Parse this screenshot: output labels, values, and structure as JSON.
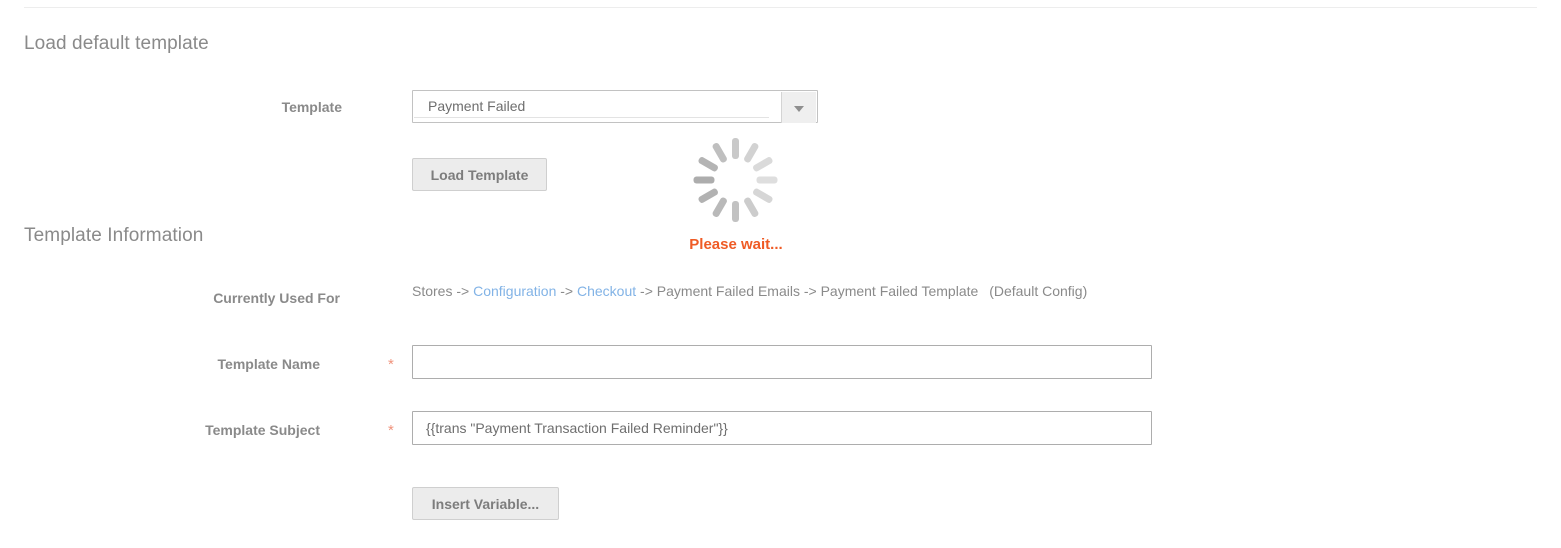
{
  "sections": {
    "load_default": "Load default template",
    "template_information": "Template Information"
  },
  "template_row": {
    "label": "Template",
    "selected_option": "Payment Failed",
    "arrow_icon": "chevron-down-icon"
  },
  "buttons": {
    "load_template": "Load Template",
    "insert_variable": "Insert Variable..."
  },
  "loader": {
    "icon": "spinner-icon",
    "message": "Please wait...",
    "accent_color": "#ef5b25",
    "spoke_colors": [
      "#c9c9c9",
      "#d2d2d2",
      "#dadada",
      "#dedede",
      "#d6d6d6",
      "#cccccc",
      "#c2c2c2",
      "#b9b9b9",
      "#b2b2b2",
      "#adadad",
      "#b4b4b4",
      "#bfbfbf"
    ]
  },
  "currently_used_for": {
    "label": "Currently Used For",
    "parts": {
      "stores": "Stores",
      "arrow1": "->",
      "configuration": "Configuration",
      "arrow2": "->",
      "checkout": "Checkout",
      "arrow3": "->",
      "payment_failed_emails": "Payment Failed Emails",
      "arrow4": "->",
      "payment_failed_template": "Payment Failed Template",
      "scope": "(Default Config)"
    },
    "link_color": "#82b3e6",
    "text_color": "#8a8a8a"
  },
  "template_name": {
    "label": "Template Name",
    "required_marker": "*",
    "value": "",
    "placeholder": ""
  },
  "template_subject": {
    "label": "Template Subject",
    "required_marker": "*",
    "value": "{{trans \"Payment Transaction Failed Reminder\"}}",
    "placeholder": ""
  },
  "colors": {
    "required_star": "#f0937c",
    "heading": "#8a8a8a",
    "label": "#8a8a8a",
    "input_border": "#adadad",
    "button_bg": "#ececec"
  }
}
